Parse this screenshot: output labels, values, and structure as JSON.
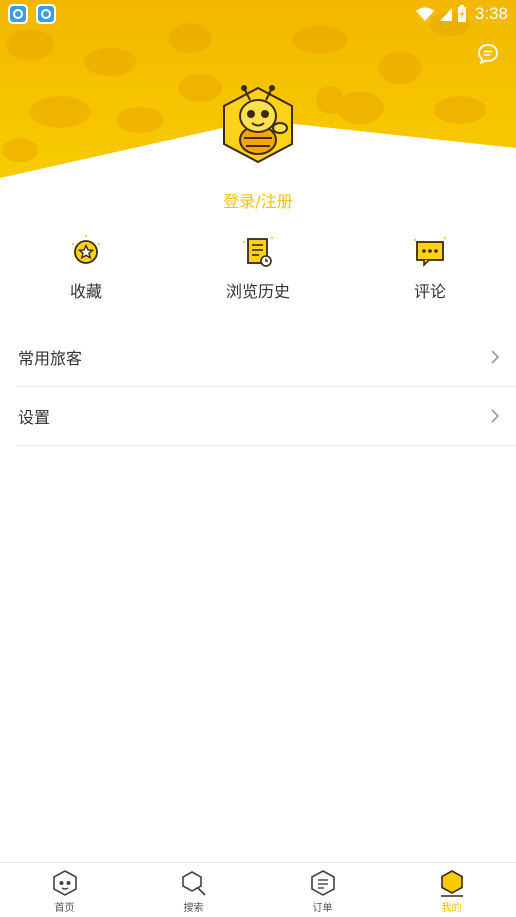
{
  "status_bar": {
    "time": "3:38",
    "notification_icons": [
      "app-notification-icon",
      "app-notification-icon"
    ],
    "indicators": [
      "wifi-icon",
      "signal-icon",
      "battery-charging-icon"
    ]
  },
  "header": {
    "chat_icon": "chat-bubble-icon",
    "avatar_icon": "bee-mascot-icon",
    "login_label": "登录/注册"
  },
  "quick_actions": [
    {
      "label": "收藏",
      "icon": "favorite-star-icon"
    },
    {
      "label": "浏览历史",
      "icon": "history-document-icon"
    },
    {
      "label": "评论",
      "icon": "comment-icon"
    }
  ],
  "menu": [
    {
      "label": "常用旅客"
    },
    {
      "label": "设置"
    }
  ],
  "tabs": [
    {
      "label": "首页",
      "icon": "home-face-icon",
      "active": false
    },
    {
      "label": "搜索",
      "icon": "search-icon",
      "active": false
    },
    {
      "label": "订单",
      "icon": "order-list-icon",
      "active": false
    },
    {
      "label": "我的",
      "icon": "profile-hexagon-icon",
      "active": true
    }
  ],
  "colors": {
    "accent": "#f3c400",
    "header_yellow": "#f6c700",
    "header_dark": "#eeb500",
    "text": "#333333",
    "divider": "#ececec"
  }
}
